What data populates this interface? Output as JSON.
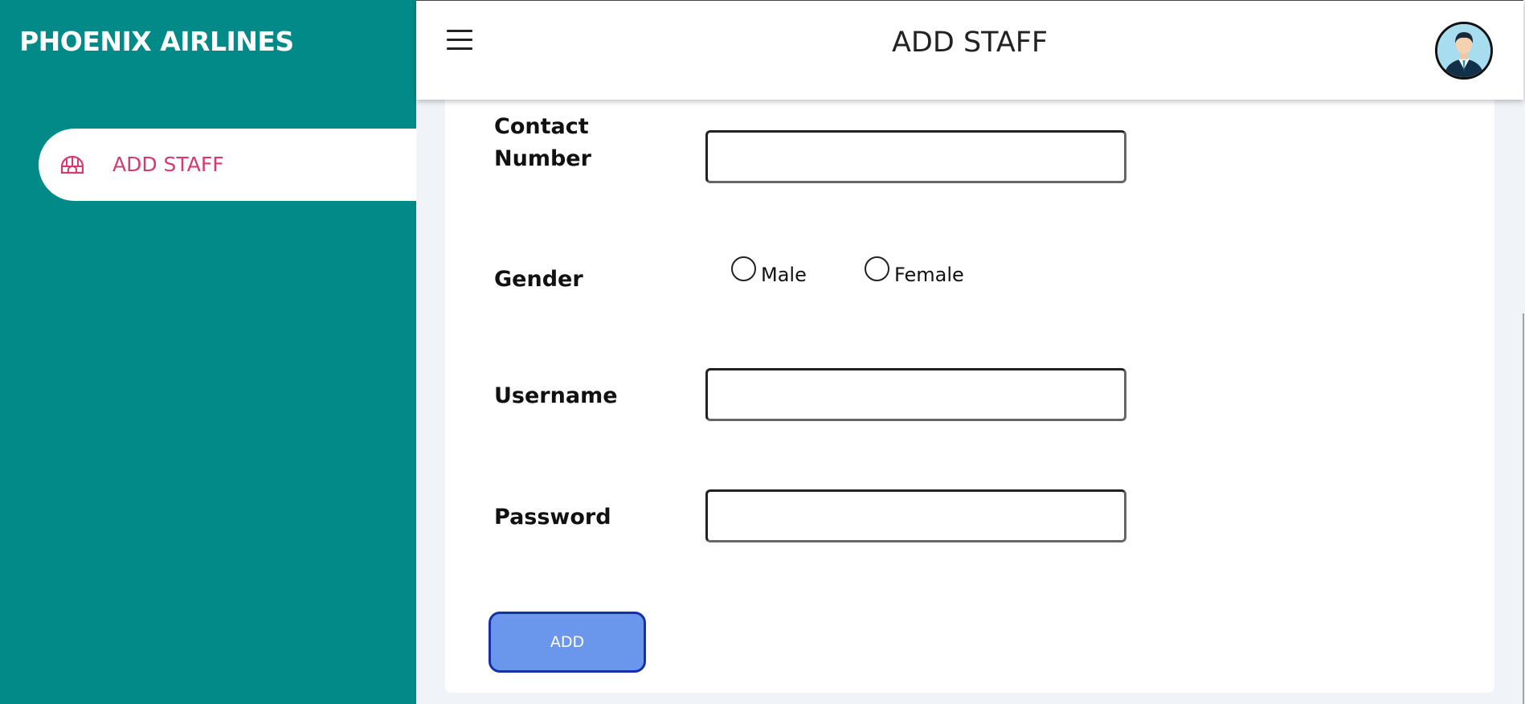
{
  "brand": {
    "name": "PHOENIX AIRLINES"
  },
  "sidebar": {
    "items": [
      {
        "label": "ADD STAFF",
        "icon": "igloo-icon"
      }
    ]
  },
  "header": {
    "title": "ADD STAFF",
    "menu_icon": "hamburger-icon",
    "avatar_icon": "user-avatar-icon"
  },
  "form": {
    "contact_label_line1": "Contact",
    "contact_label_line2": "Number",
    "contact_value": "",
    "gender_label": "Gender",
    "gender_options": [
      "Male",
      "Female"
    ],
    "gender_selected": null,
    "username_label": "Username",
    "username_value": "",
    "password_label": "Password",
    "password_value": "",
    "submit_label": "ADD"
  },
  "colors": {
    "sidebar_bg": "#018a88",
    "nav_label": "#d63b6e",
    "button_bg": "#6a97ec",
    "button_border": "#1630a8",
    "page_bg": "#f0f3f7"
  }
}
